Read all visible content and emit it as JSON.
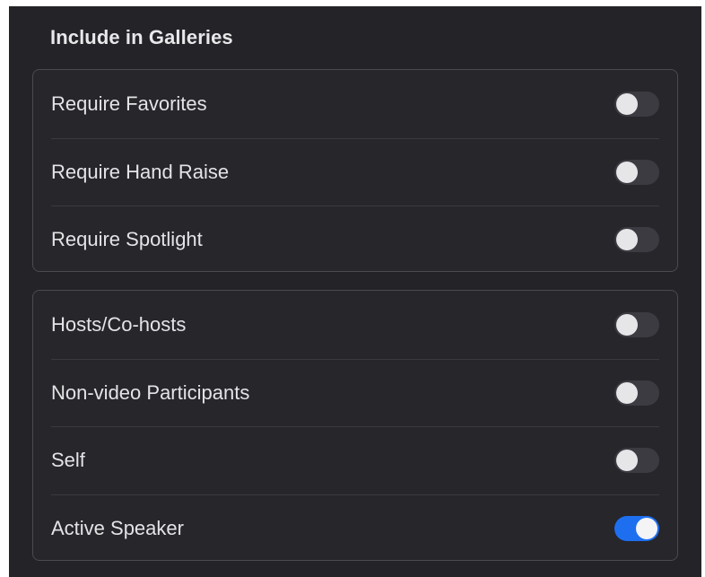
{
  "section": {
    "title": "Include in Galleries"
  },
  "group1": {
    "items": [
      {
        "label": "Require Favorites",
        "on": false
      },
      {
        "label": "Require Hand Raise",
        "on": false
      },
      {
        "label": "Require Spotlight",
        "on": false
      }
    ]
  },
  "group2": {
    "items": [
      {
        "label": "Hosts/Co-hosts",
        "on": false
      },
      {
        "label": "Non-video Participants",
        "on": false
      },
      {
        "label": "Self",
        "on": false
      },
      {
        "label": "Active Speaker",
        "on": true
      }
    ]
  },
  "colors": {
    "background": "#242428",
    "toggle_on": "#1e6ff0",
    "toggle_off": "#3b3b41"
  }
}
